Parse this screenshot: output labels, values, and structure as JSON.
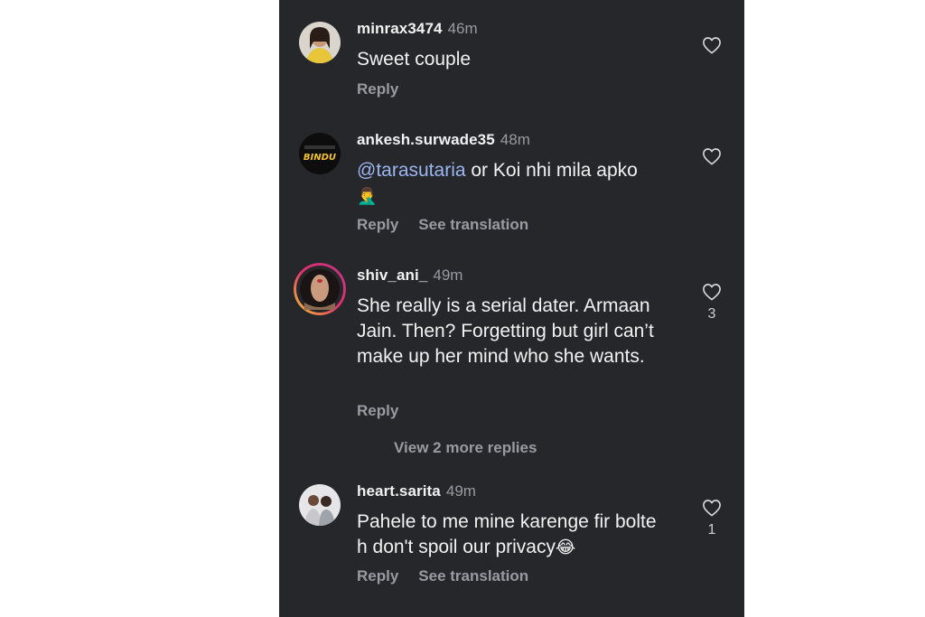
{
  "comments": [
    {
      "username": "minrax3474",
      "time": "46m",
      "text": "Sweet couple",
      "reply_label": "Reply",
      "like_count": ""
    },
    {
      "username": "ankesh.surwade35",
      "time": "48m",
      "mention": "@tarasutaria",
      "text": " or Koi nhi mila apko",
      "emoji": "🤦‍♂️",
      "avatar_text": "BINDU",
      "reply_label": "Reply",
      "translation_label": "See translation",
      "like_count": ""
    },
    {
      "username": "shiv_ani_",
      "time": "49m",
      "text": "She really is a serial dater. Armaan Jain. Then?  Forgetting but girl can’t make up her mind who she wants.",
      "reply_label": "Reply",
      "like_count": "3",
      "view_replies_label": "View 2 more replies"
    },
    {
      "username": "heart.sarita",
      "time": "49m",
      "text": "Pahele to me mine karenge fir bolte h don't spoil our privacy",
      "emoji": "😂",
      "reply_label": "Reply",
      "translation_label": "See translation",
      "like_count": "1"
    }
  ],
  "colors": {
    "background": "#26272b",
    "username": "#f2f2f2",
    "secondary": "#9a9aa0",
    "mention": "#9cb6f0",
    "story_ring": "#c13584"
  },
  "icons": [
    "heart-icon"
  ]
}
